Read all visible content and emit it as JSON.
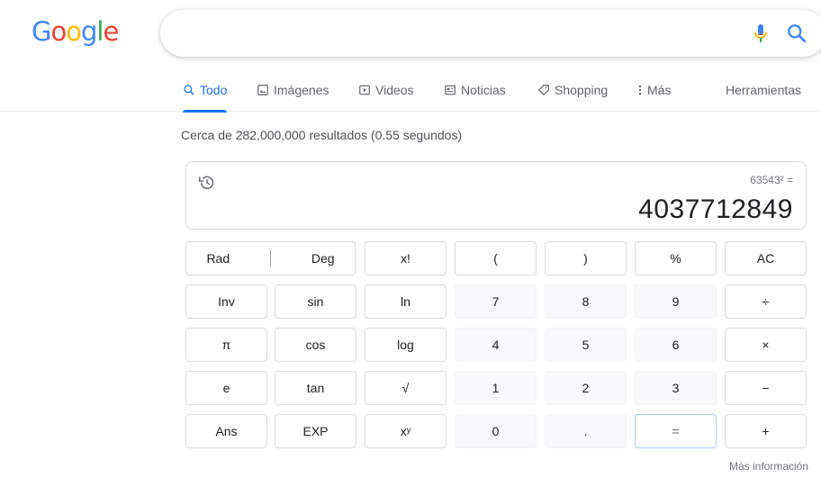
{
  "logo": [
    "G",
    "o",
    "o",
    "g",
    "l",
    "e"
  ],
  "search": {
    "value": "",
    "placeholder": ""
  },
  "tabs": [
    {
      "label": "Todo",
      "icon": "search-icon"
    },
    {
      "label": "Imágenes",
      "icon": "image-icon"
    },
    {
      "label": "Videos",
      "icon": "video-icon"
    },
    {
      "label": "Noticias",
      "icon": "news-icon"
    },
    {
      "label": "Shopping",
      "icon": "tag-icon"
    },
    {
      "label": "Más",
      "icon": "more-vert-icon"
    }
  ],
  "tools_label": "Herramientas",
  "results_text": "Cerca de 282,000,000 resultados (0.55 segundos)",
  "calculator": {
    "expression": "63543² =",
    "value": "4037712849",
    "keys": {
      "rad": "Rad",
      "deg": "Deg",
      "fact": "x!",
      "lparen": "(",
      "rparen": ")",
      "pct": "%",
      "ac": "AC",
      "inv": "Inv",
      "sin": "sin",
      "ln": "ln",
      "k7": "7",
      "k8": "8",
      "k9": "9",
      "div": "÷",
      "pi": "π",
      "cos": "cos",
      "log": "log",
      "k4": "4",
      "k5": "5",
      "k6": "6",
      "mul": "×",
      "e": "e",
      "tan": "tan",
      "sqrt": "√",
      "k1": "1",
      "k2": "2",
      "k3": "3",
      "sub": "−",
      "ans": "Ans",
      "exp": "EXP",
      "pow": "xʸ",
      "k0": "0",
      "dot": ".",
      "eq": "=",
      "add": "+"
    }
  },
  "more_info": "Más información",
  "colors": {
    "blue": "#4285f4",
    "red": "#ea4335",
    "yellow": "#fbbc05",
    "green": "#34a853",
    "active_tab": "#1a73e8"
  }
}
